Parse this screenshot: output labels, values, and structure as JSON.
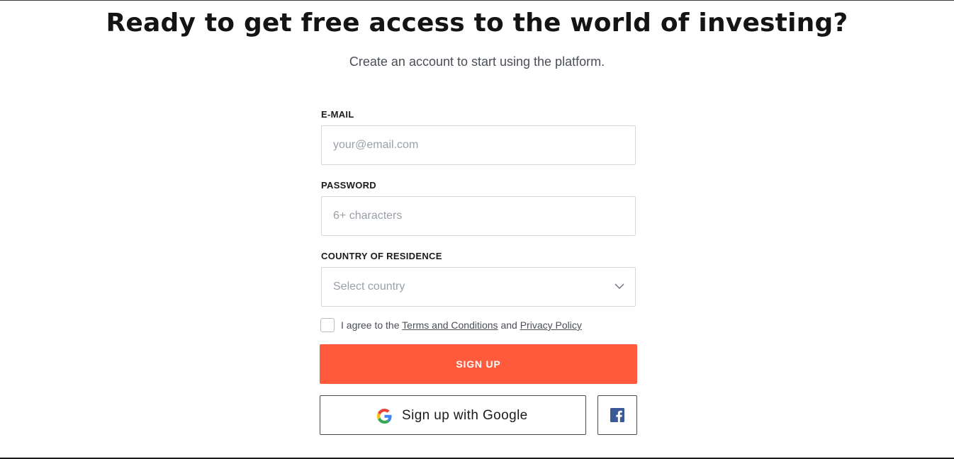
{
  "header": {
    "title": "Ready to get free access to the world of investing?",
    "subtitle": "Create an account to start using the platform."
  },
  "form": {
    "email": {
      "label": "E-MAIL",
      "placeholder": "your@email.com",
      "value": ""
    },
    "password": {
      "label": "PASSWORD",
      "placeholder": "6+ characters",
      "value": ""
    },
    "country": {
      "label": "COUNTRY OF RESIDENCE",
      "selected": "Select country",
      "icon": "chevron-down-icon"
    },
    "agreement": {
      "checked": false,
      "prefix": "I agree to the",
      "terms_link": "Terms and Conditions",
      "conjunction": "and",
      "privacy_link": "Privacy Policy"
    },
    "signup_button": "SIGN UP",
    "google_button": "Sign up with Google",
    "google_icon": "google-icon",
    "facebook_icon": "facebook-icon"
  },
  "colors": {
    "accent": "#ff5a3c",
    "facebook": "#3b5998",
    "text_dark": "#141414",
    "text_muted": "#4a4e57",
    "placeholder": "#9aa0a8"
  }
}
